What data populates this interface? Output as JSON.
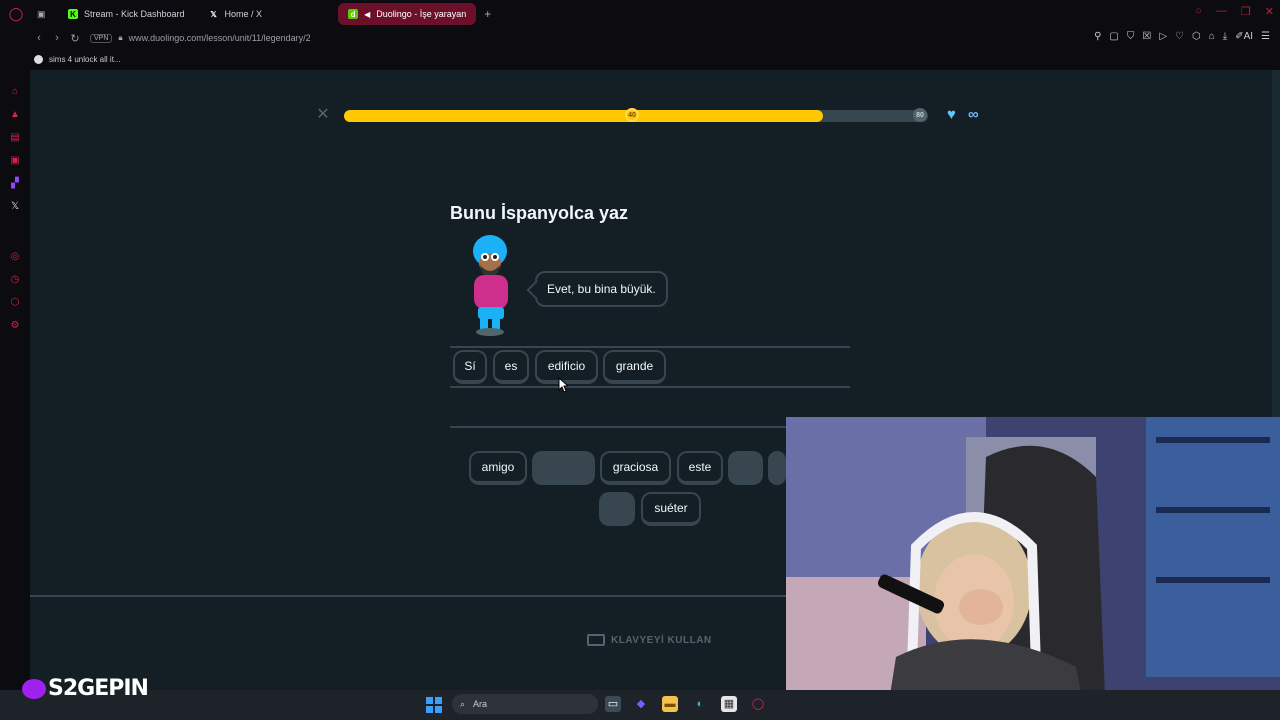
{
  "browser": {
    "tabs": [
      {
        "label": "Stream - Kick Dashboard",
        "active": false
      },
      {
        "label": "Home / X",
        "active": false
      },
      {
        "label": "Duolingo - İşe yarayan",
        "active": true
      }
    ],
    "url": "www.duolingo.com/lesson/unit/11/legendary/2",
    "vpn_label": "VPN",
    "bookmark": "sims 4 unlock all it..."
  },
  "lesson": {
    "progress": {
      "value": 0.82,
      "marker_mid": "40",
      "marker_end": "80"
    },
    "hearts": "∞",
    "title": "Bunu İspanyolca yaz",
    "prompt_sentence": "Evet, bu bina büyük.",
    "answer_words": [
      "Sí",
      "es",
      "edificio",
      "grande"
    ],
    "bank_row1": [
      "amigo",
      "",
      "graciosa",
      "este",
      ""
    ],
    "bank_row2": [
      "",
      "suéter"
    ],
    "keyboard_label": "KLAVYEYİ KULLAN"
  },
  "taskbar": {
    "search_placeholder": "Ara"
  },
  "watermark": "S2GEPIN",
  "colors": {
    "background": "#131f24",
    "progress_fill": "#ffc800",
    "border": "#37464f",
    "accent_browser": "#d2244a"
  }
}
